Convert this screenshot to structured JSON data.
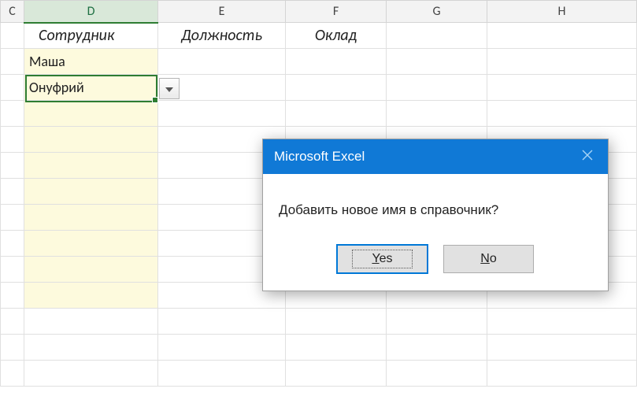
{
  "columns": {
    "c": "C",
    "d": "D",
    "e": "E",
    "f": "F",
    "g": "G",
    "h": "H"
  },
  "headers": {
    "d": "Сотрудник",
    "e": "Должность",
    "f": "Оклад"
  },
  "rows": {
    "r1": "Маша",
    "r2": "Онуфрий"
  },
  "dialog": {
    "title": "Microsoft Excel",
    "message": "Добавить новое имя в справочник?",
    "yes_prefix": "Y",
    "yes_rest": "es",
    "no_prefix": "N",
    "no_rest": "o"
  }
}
